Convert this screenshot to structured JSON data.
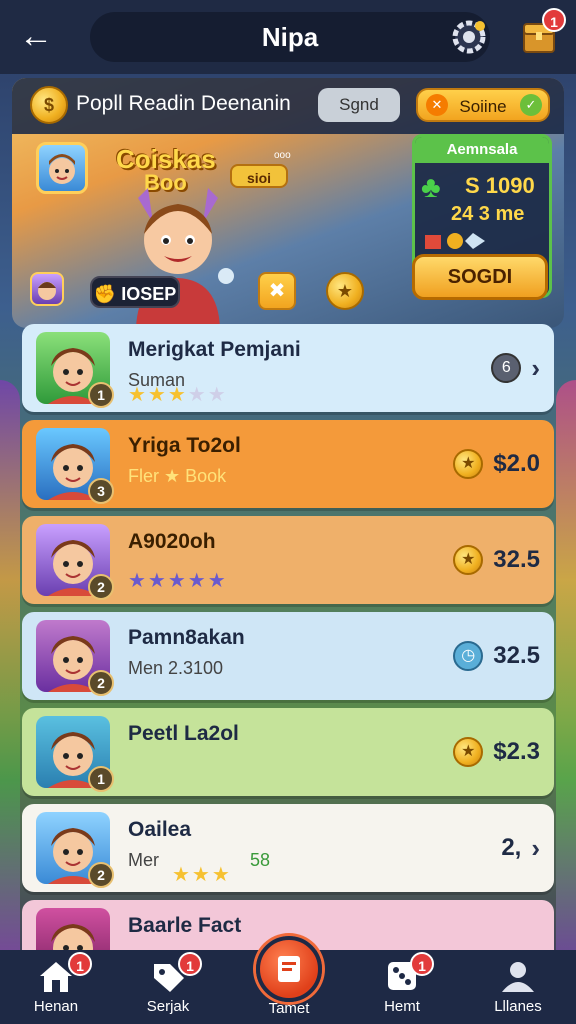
{
  "header": {
    "title": "Nipa",
    "chest_badge": "1"
  },
  "hero": {
    "strip_title": "Popll Readin Deenanin",
    "send_label": "Sgnd",
    "online_label": "Soiine",
    "brand_line1": "Coiskas",
    "brand_line2": "Boo",
    "tag_label": "sioi",
    "tiny_text": "ooo",
    "pill_label": "IOSEP",
    "reward": {
      "title": "Aemnsala",
      "value1": "S 1090",
      "value2": "24 3 me",
      "button": "SOGDI"
    }
  },
  "list": [
    {
      "name": "Merigkat Pemjani",
      "sub": "Suman",
      "level": "1",
      "stars": 5,
      "filled": 3,
      "price": "",
      "right_icon": "6",
      "theme": "blue"
    },
    {
      "name": "Yriga To2ol",
      "sub": "Fler ★ Book",
      "level": "3",
      "stars": 0,
      "filled": 0,
      "price": "$2.0",
      "right_icon": "coin",
      "theme": "orange"
    },
    {
      "name": "A9020oh",
      "sub": "",
      "level": "2",
      "stars": 5,
      "filled": 0,
      "price": "32.5",
      "right_icon": "coin",
      "theme": "tan"
    },
    {
      "name": "Pamn8akan",
      "sub": "Men 2.3100",
      "level": "2",
      "stars": 0,
      "filled": 0,
      "price": "32.5",
      "right_icon": "clock",
      "theme": "lightblue"
    },
    {
      "name": "Peetl La2ol",
      "sub": "",
      "level": "1",
      "stars": 0,
      "filled": 0,
      "price": "$2.3",
      "right_icon": "coin",
      "theme": "green"
    },
    {
      "name": "Oailea",
      "sub": "Mer",
      "sub2": "58",
      "level": "2",
      "stars": 3,
      "filled": 3,
      "price": "2,",
      "right_icon": "chev",
      "theme": "white"
    },
    {
      "name": "Baarle Fact",
      "sub": "",
      "level": "",
      "stars": 0,
      "filled": 0,
      "price": "",
      "right_icon": "",
      "theme": "pink"
    }
  ],
  "nav": {
    "items": [
      {
        "label": "Henan",
        "badge": "1"
      },
      {
        "label": "Serjak",
        "badge": "1"
      },
      {
        "label": "Tamet",
        "badge": ""
      },
      {
        "label": "Hemt",
        "badge": "1"
      },
      {
        "label": "Lllanes",
        "badge": ""
      }
    ]
  },
  "colors": {
    "topbar": "#1f2a44",
    "accent_gold": "#f0b020",
    "badge_red": "#e23b3b",
    "row_orange": "#f49a3a",
    "row_blue": "#cfe6f6",
    "row_green": "#c5e39a"
  }
}
